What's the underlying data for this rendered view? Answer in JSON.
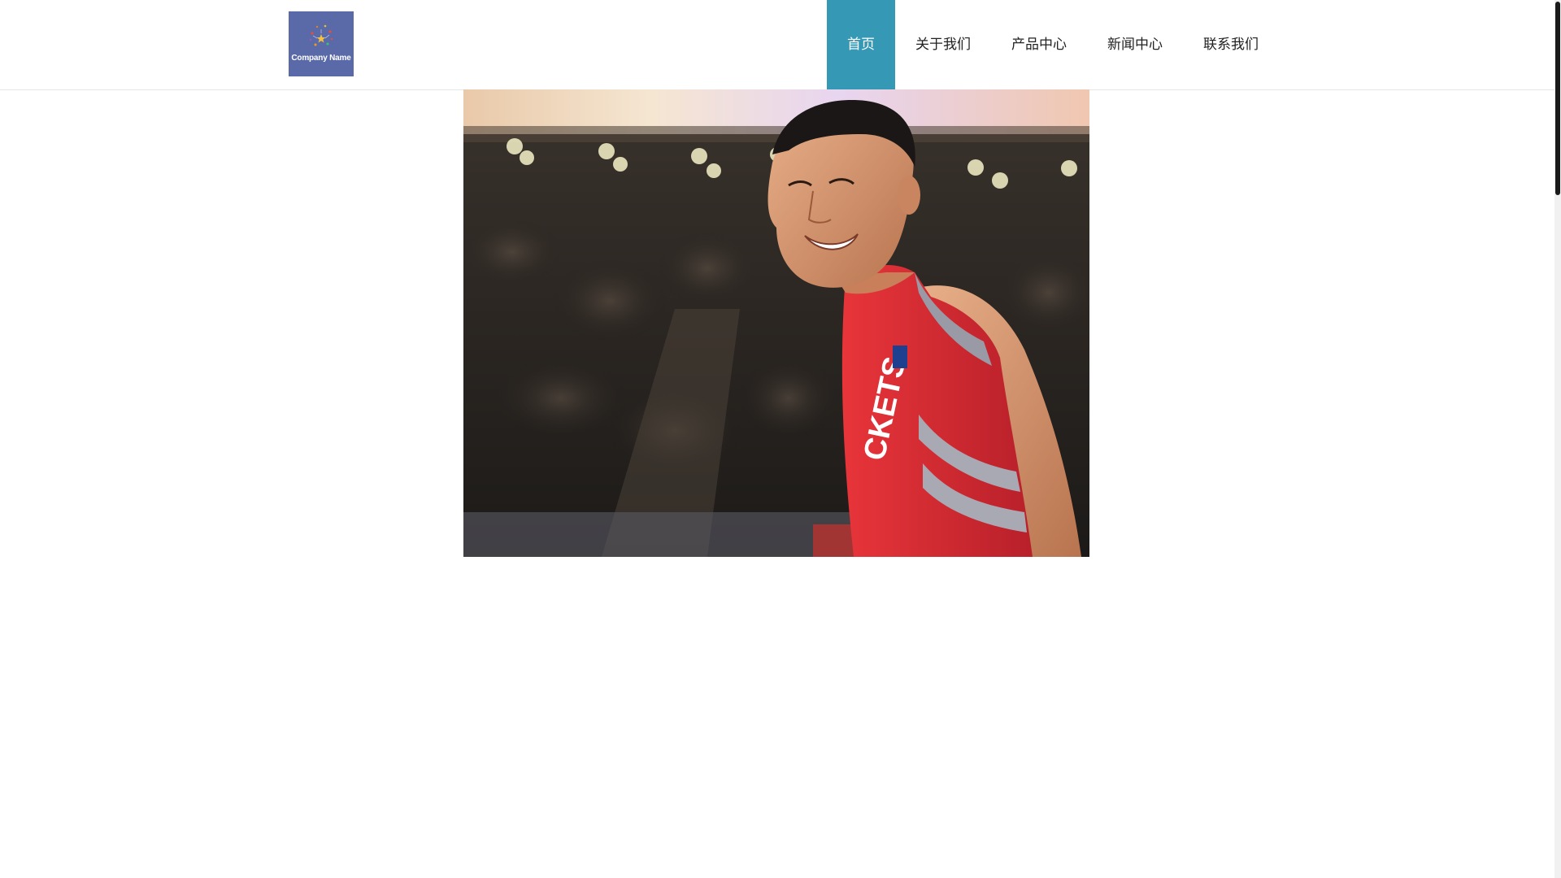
{
  "header": {
    "logo_text": "Company Name",
    "nav": [
      {
        "label": "首页",
        "active": true
      },
      {
        "label": "关于我们",
        "active": false
      },
      {
        "label": "产品中心",
        "active": false
      },
      {
        "label": "新闻中心",
        "active": false
      },
      {
        "label": "联系我们",
        "active": false
      }
    ]
  },
  "colors": {
    "accent": "#3598b5",
    "logo_bg": "#5a6aa8",
    "jersey_red": "#d42a2f"
  },
  "hero": {
    "image": "basketball-player-photo"
  }
}
